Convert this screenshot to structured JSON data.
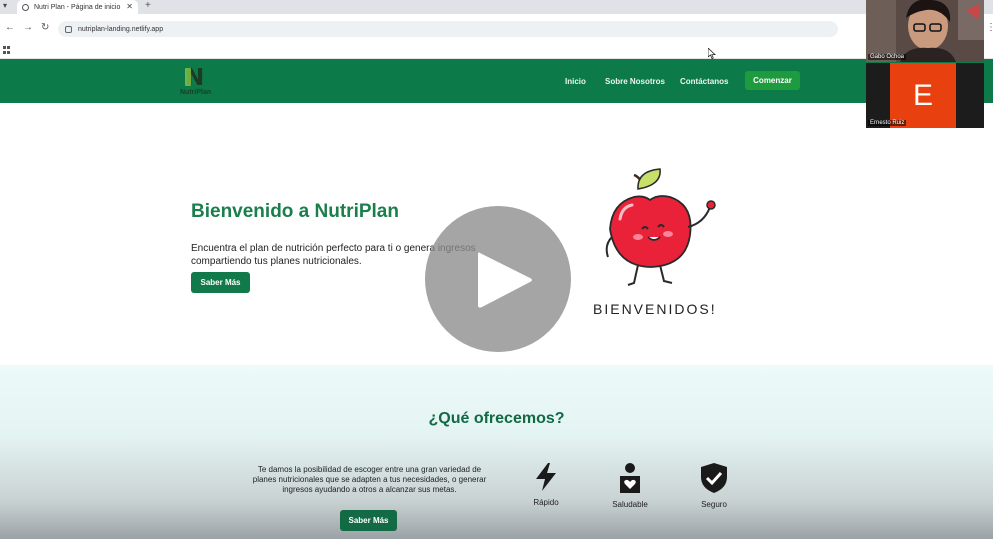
{
  "browser": {
    "tab_title": "Nutri Plan - Página de inicio",
    "url": "nutriplan-landing.netlify.app"
  },
  "header": {
    "logo_text": "NutriPlan",
    "nav": [
      "Inicio",
      "Sobre Nosotros",
      "Contáctanos"
    ],
    "cta_label": "Comenzar",
    "color": "#0d7a4a"
  },
  "hero": {
    "title": "Bienvenido a NutriPlan",
    "text": "Encuentra el plan de nutrición perfecto para ti o genera ingresos compartiendo tus planes nutricionales.",
    "button_label": "Saber Más",
    "illustration_caption": "BIENVENIDOS!"
  },
  "offer": {
    "title": "¿Qué ofrecemos?",
    "text": "Te damos la posibilidad de escoger entre una gran variedad de planes nutricionales que se adapten a tus necesidades, o generar ingresos ayudando a otros a alcanzar sus metas.",
    "button_label": "Saber Más",
    "features": [
      {
        "label": "Rápido",
        "icon": "bolt-icon"
      },
      {
        "label": "Saludable",
        "icon": "health-person-icon"
      },
      {
        "label": "Seguro",
        "icon": "shield-check-icon"
      }
    ]
  },
  "video_call": {
    "participants": [
      {
        "name": "Gabo Ochoa"
      },
      {
        "name": "Ernesto Ruiz",
        "initial": "E"
      }
    ]
  }
}
